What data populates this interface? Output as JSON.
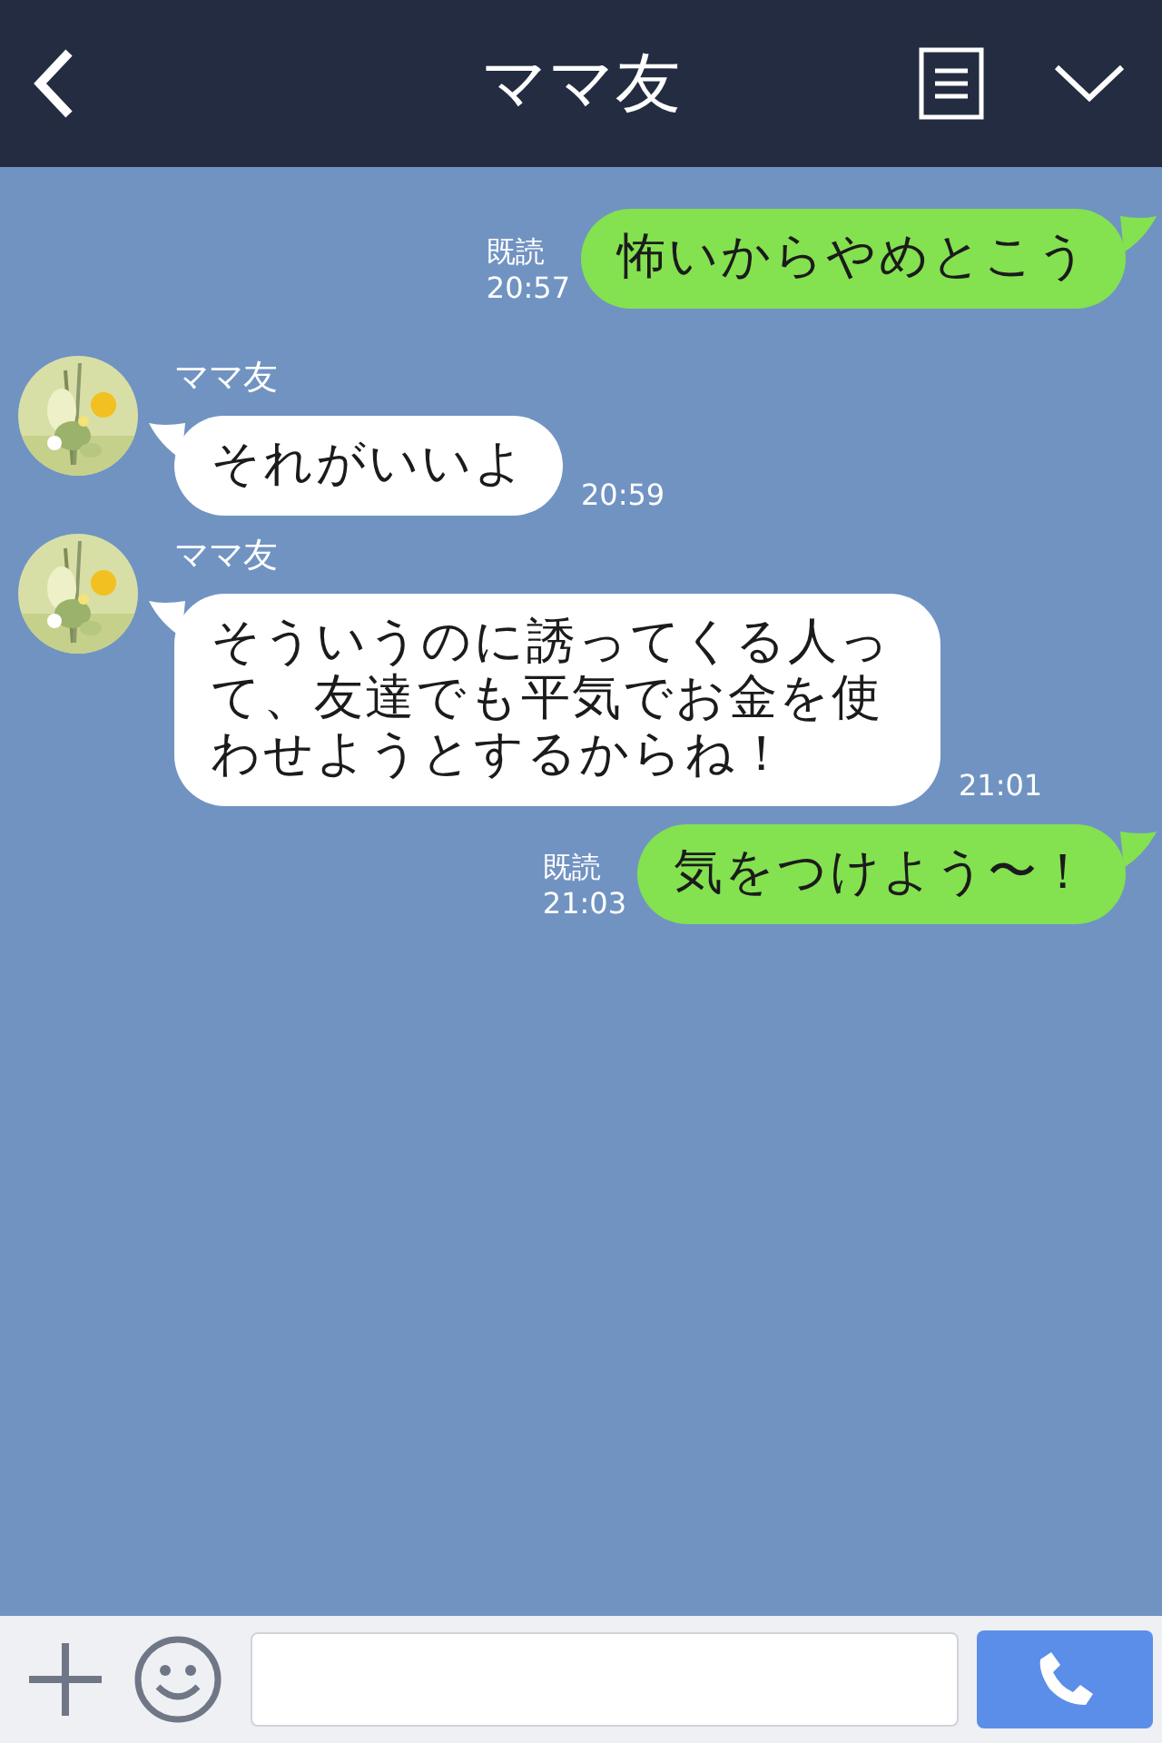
{
  "header": {
    "title": "ママ友"
  },
  "messages": [
    {
      "kind": "sent",
      "text": "怖いからやめとこう",
      "read": "既読",
      "time": "20:57"
    },
    {
      "kind": "received",
      "sender": "ママ友",
      "text": "それがいいよ",
      "time": "20:59"
    },
    {
      "kind": "received",
      "sender": "ママ友",
      "text": "そういうのに誘ってくる人って、友達でも平気でお金を使わせようとするからね！",
      "time": "21:01"
    },
    {
      "kind": "sent",
      "text": "気をつけよう〜！",
      "read": "既読",
      "time": "21:03"
    }
  ]
}
